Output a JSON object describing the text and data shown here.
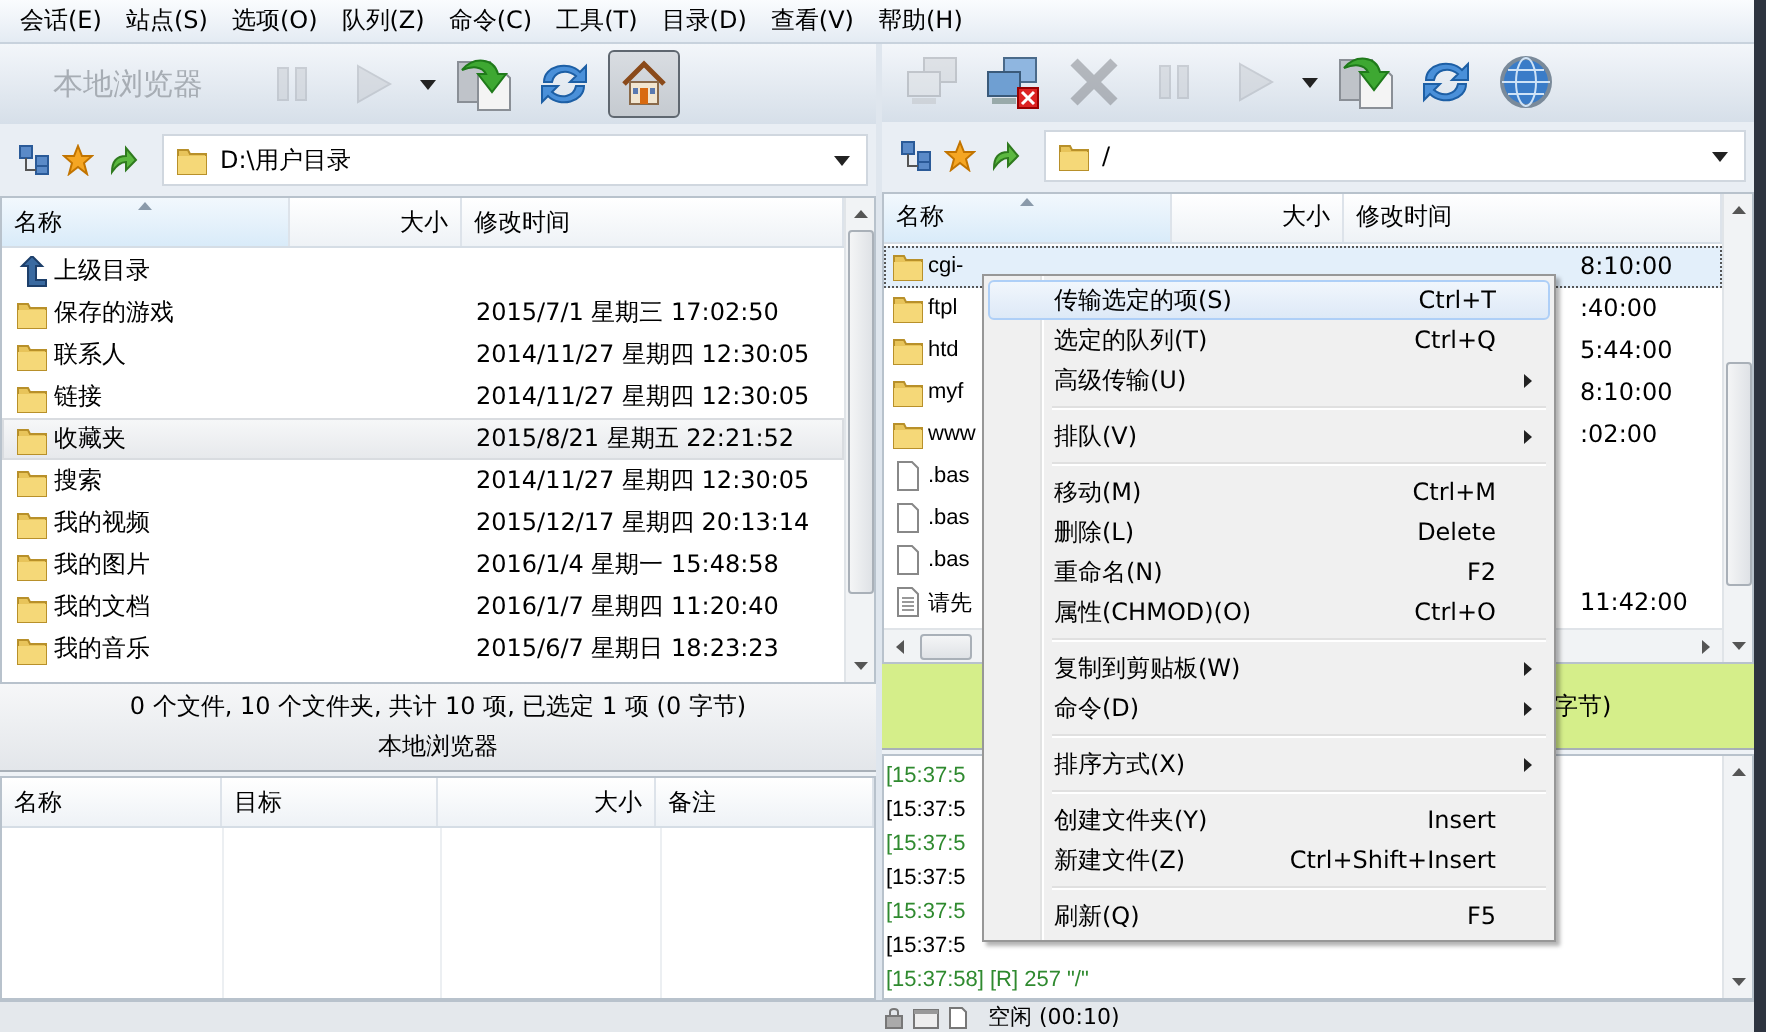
{
  "menu_bar": [
    "会话(E)",
    "站点(S)",
    "选项(O)",
    "队列(Z)",
    "命令(C)",
    "工具(T)",
    "目录(D)",
    "查看(V)",
    "帮助(H)"
  ],
  "local": {
    "title": "本地浏览器",
    "buttons": [
      {
        "kind": "pause",
        "disabled": true,
        "pressed": false
      },
      {
        "kind": "play",
        "disabled": true,
        "pressed": false
      },
      {
        "kind": "dropdown",
        "disabled": false,
        "pressed": false
      },
      {
        "kind": "transfer",
        "disabled": false,
        "pressed": false
      },
      {
        "kind": "refresh",
        "disabled": false,
        "pressed": false
      },
      {
        "kind": "home",
        "disabled": false,
        "pressed": true
      }
    ],
    "path": "D:\\用户目录",
    "columns": [
      "名称",
      "大小",
      "修改时间"
    ],
    "rows": [
      {
        "kind": "parent",
        "name": "上级目录",
        "selected": false
      },
      {
        "kind": "folder",
        "name": "保存的游戏",
        "modified": "2015/7/1 星期三 17:02:50",
        "selected": false
      },
      {
        "kind": "folder",
        "name": "联系人",
        "modified": "2014/11/27 星期四 12:30:05",
        "selected": false
      },
      {
        "kind": "folder",
        "name": "链接",
        "modified": "2014/11/27 星期四 12:30:05",
        "selected": false
      },
      {
        "kind": "folder",
        "name": "收藏夹",
        "modified": "2015/8/21 星期五 22:21:52",
        "selected": true
      },
      {
        "kind": "folder",
        "name": "搜索",
        "modified": "2014/11/27 星期四 12:30:05",
        "selected": false
      },
      {
        "kind": "folder",
        "name": "我的视频",
        "modified": "2015/12/17 星期四 20:13:14",
        "selected": false
      },
      {
        "kind": "folder",
        "name": "我的图片",
        "modified": "2016/1/4 星期一 15:48:58",
        "selected": false
      },
      {
        "kind": "folder",
        "name": "我的文档",
        "modified": "2016/1/7 星期四 11:20:40",
        "selected": false
      },
      {
        "kind": "folder",
        "name": "我的音乐",
        "modified": "2015/6/7 星期日 18:23:23",
        "selected": false
      }
    ],
    "status": "0 个文件, 10 个文件夹, 共计 10 项, 已选定 1 项 (0 字节)",
    "caption": "本地浏览器"
  },
  "remote": {
    "buttons": [
      {
        "kind": "connect",
        "disabled": true,
        "pressed": false
      },
      {
        "kind": "disconnect",
        "disabled": false,
        "pressed": false
      },
      {
        "kind": "abort",
        "disabled": true,
        "pressed": false
      },
      {
        "kind": "pause",
        "disabled": true,
        "pressed": false
      },
      {
        "kind": "play",
        "disabled": true,
        "pressed": false
      },
      {
        "kind": "dropdown",
        "disabled": false,
        "pressed": false
      },
      {
        "kind": "transfer",
        "disabled": false,
        "pressed": false
      },
      {
        "kind": "refresh",
        "disabled": false,
        "pressed": false
      },
      {
        "kind": "globe",
        "disabled": false,
        "pressed": false
      }
    ],
    "path": "/",
    "columns": [
      "名称",
      "大小",
      "修改时间"
    ],
    "rows": [
      {
        "kind": "folder",
        "name": "cgi-",
        "modified": "8:10:00",
        "selected": true
      },
      {
        "kind": "folder",
        "name": "ftpl",
        "modified": ":40:00",
        "selected": false
      },
      {
        "kind": "folder",
        "name": "htd",
        "modified": "5:44:00",
        "selected": false
      },
      {
        "kind": "folder",
        "name": "myf",
        "modified": "8:10:00",
        "selected": false
      },
      {
        "kind": "folder",
        "name": "www",
        "modified": ":02:00",
        "selected": false
      },
      {
        "kind": "file",
        "name": ".bas",
        "selected": false
      },
      {
        "kind": "file",
        "name": ".bas",
        "selected": false
      },
      {
        "kind": "file",
        "name": ".bas",
        "selected": false
      },
      {
        "kind": "text",
        "name": "请先",
        "modified": "11:42:00",
        "selected": false
      }
    ],
    "status": "字节)"
  },
  "queue": {
    "columns": [
      "名称",
      "目标",
      "大小",
      "备注"
    ]
  },
  "log": [
    {
      "kind": "reply",
      "text": "[15:37:5"
    },
    {
      "kind": "command",
      "text": "[15:37:5"
    },
    {
      "kind": "reply",
      "text": "[15:37:5"
    },
    {
      "kind": "command",
      "text": "[15:37:5"
    },
    {
      "kind": "reply",
      "text": "[15:37:5"
    },
    {
      "kind": "command",
      "text": "[15:37:5"
    },
    {
      "kind": "reply",
      "text": "[15:37:58] [R] 257 \"/\""
    }
  ],
  "status_bar": {
    "text": "空闲 (00:10)"
  },
  "context_menu": [
    {
      "kind": "item",
      "label": "传输选定的项(S)",
      "shortcut": "Ctrl+T",
      "submenu": false,
      "selected": true
    },
    {
      "kind": "item",
      "label": "选定的队列(T)",
      "shortcut": "Ctrl+Q",
      "submenu": false,
      "selected": false
    },
    {
      "kind": "item",
      "label": "高级传输(U)",
      "submenu": true,
      "selected": false
    },
    {
      "kind": "separator"
    },
    {
      "kind": "item",
      "label": "排队(V)",
      "submenu": true,
      "selected": false
    },
    {
      "kind": "separator"
    },
    {
      "kind": "item",
      "label": "移动(M)",
      "shortcut": "Ctrl+M",
      "submenu": false,
      "selected": false
    },
    {
      "kind": "item",
      "label": "删除(L)",
      "shortcut": "Delete",
      "submenu": false,
      "selected": false
    },
    {
      "kind": "item",
      "label": "重命名(N)",
      "shortcut": "F2",
      "submenu": false,
      "selected": false
    },
    {
      "kind": "item",
      "label": "属性(CHMOD)(O)",
      "shortcut": "Ctrl+O",
      "submenu": false,
      "selected": false
    },
    {
      "kind": "separator"
    },
    {
      "kind": "item",
      "label": "复制到剪贴板(W)",
      "submenu": true,
      "selected": false
    },
    {
      "kind": "item",
      "label": "命令(D)",
      "submenu": true,
      "selected": false
    },
    {
      "kind": "separator"
    },
    {
      "kind": "item",
      "label": "排序方式(X)",
      "submenu": true,
      "selected": false
    },
    {
      "kind": "separator"
    },
    {
      "kind": "item",
      "label": "创建文件夹(Y)",
      "shortcut": "Insert",
      "submenu": false,
      "selected": false
    },
    {
      "kind": "item",
      "label": "新建文件(Z)",
      "shortcut": "Ctrl+Shift+Insert",
      "submenu": false,
      "selected": false
    },
    {
      "kind": "separator"
    },
    {
      "kind": "item",
      "label": "刷新(Q)",
      "shortcut": "F5",
      "submenu": false,
      "selected": false
    }
  ]
}
